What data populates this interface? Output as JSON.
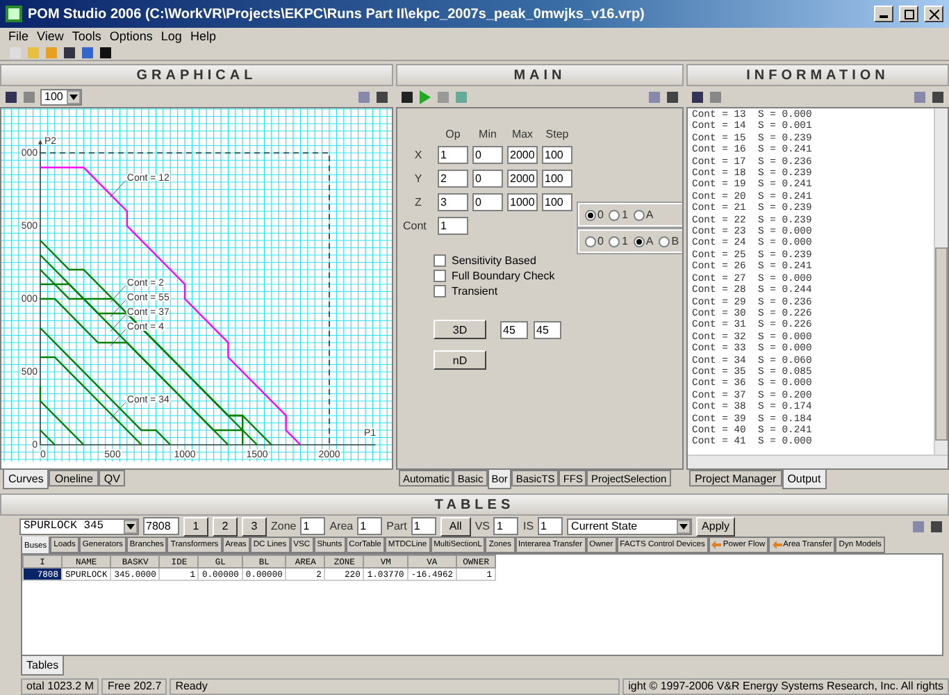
{
  "window": {
    "title": "POM Studio 2006 (C:\\WorkVR\\Projects\\EKPC\\Runs Part II\\ekpc_2007s_peak_0mwjks_v16.vrp)"
  },
  "menu": [
    "File",
    "View",
    "Tools",
    "Options",
    "Log",
    "Help"
  ],
  "graphical": {
    "title": "GRAPHICAL",
    "zoom": "100",
    "y_tick_labels": [
      "000",
      "500",
      "000"
    ],
    "chart_data": {
      "type": "line",
      "xlabel": "P1",
      "ylabel": "P2",
      "xlim": [
        0,
        2300
      ],
      "ylim": [
        0,
        2100
      ],
      "grid": true,
      "xticks": [
        0,
        500,
        1000,
        1500,
        2000
      ],
      "yticks": [
        0,
        500
      ],
      "series": [
        {
          "color": "#ff00ff",
          "x": [
            0,
            300,
            600,
            600,
            1000,
            1000,
            1300,
            1300,
            1700,
            1700,
            1800
          ],
          "values": [
            1900,
            1900,
            1600,
            1500,
            1100,
            1000,
            700,
            600,
            200,
            100,
            0
          ]
        },
        {
          "color": "#008000",
          "x": [
            0,
            200,
            300,
            1500
          ],
          "values": [
            1400,
            1200,
            1200,
            0
          ]
        },
        {
          "color": "#008000",
          "x": [
            0,
            300,
            500,
            1300,
            1400,
            1600
          ],
          "values": [
            1300,
            1000,
            1000,
            200,
            200,
            0
          ]
        },
        {
          "color": "#008000",
          "x": [
            0,
            200,
            300,
            1300
          ],
          "values": [
            1200,
            1000,
            1000,
            0
          ]
        },
        {
          "color": "#008000",
          "x": [
            0,
            200,
            400,
            600,
            1300,
            1400,
            1400
          ],
          "values": [
            1100,
            1100,
            900,
            900,
            200,
            200,
            0
          ]
        },
        {
          "color": "#008000",
          "x": [
            0,
            100,
            400,
            600,
            1200,
            1400
          ],
          "values": [
            1000,
            1000,
            700,
            700,
            100,
            100
          ]
        },
        {
          "color": "#008000",
          "x": [
            0,
            700,
            800,
            900
          ],
          "values": [
            800,
            100,
            100,
            0
          ]
        },
        {
          "color": "#008000",
          "x": [
            0,
            100,
            700
          ],
          "values": [
            600,
            600,
            0
          ]
        },
        {
          "color": "#008000",
          "x": [
            0,
            0,
            300
          ],
          "values": [
            400,
            300,
            0
          ]
        },
        {
          "color": "#008000",
          "x": [
            0,
            100
          ],
          "values": [
            100,
            0
          ]
        }
      ],
      "annotations": [
        "Cont = 12",
        "Cont = 2",
        "Cont = 55",
        "Cont = 37",
        "Cont = 4",
        "Cont = 34"
      ]
    },
    "tabs": [
      {
        "label": "Curves",
        "selected": true
      },
      {
        "label": "Oneline",
        "selected": false
      },
      {
        "label": "QV",
        "selected": false
      }
    ]
  },
  "main": {
    "title": "MAIN",
    "columns": [
      "Op",
      "Min",
      "Max",
      "Step"
    ],
    "rows": [
      {
        "label": "X",
        "values": [
          "1",
          "0",
          "2000",
          "100"
        ]
      },
      {
        "label": "Y",
        "values": [
          "2",
          "0",
          "2000",
          "100"
        ]
      },
      {
        "label": "Z",
        "values": [
          "3",
          "0",
          "1000",
          "100"
        ]
      }
    ],
    "cont": {
      "label": "Cont",
      "value": "1"
    },
    "radio_groups": [
      [
        {
          "label": "0",
          "selected": true
        },
        {
          "label": "1",
          "selected": false
        },
        {
          "label": "A",
          "selected": false
        }
      ],
      [
        {
          "label": "0",
          "selected": false
        },
        {
          "label": "1",
          "selected": false
        },
        {
          "label": "A",
          "selected": true
        },
        {
          "label": "B",
          "selected": false
        }
      ]
    ],
    "checkboxes": [
      {
        "label": "Sensitivity Based",
        "checked": false
      },
      {
        "label": "Full Boundary Check",
        "checked": false
      },
      {
        "label": "Transient",
        "checked": false
      }
    ],
    "button_3d": "3D",
    "angles": [
      "45",
      "45"
    ],
    "button_nd": "nD",
    "tabs": [
      {
        "label": "Automatic",
        "selected": false
      },
      {
        "label": "Basic",
        "selected": false
      },
      {
        "label": "Bor",
        "selected": true
      },
      {
        "label": "BasicTS",
        "selected": false
      },
      {
        "label": "FFS",
        "selected": false
      },
      {
        "label": "ProjectSelection",
        "selected": false
      }
    ]
  },
  "information": {
    "title": "INFORMATION",
    "lines": [
      "Cont = 13  S = 0.000",
      "Cont = 14  S = 0.001",
      "Cont = 15  S = 0.239",
      "Cont = 16  S = 0.241",
      "Cont = 17  S = 0.236",
      "Cont = 18  S = 0.239",
      "Cont = 19  S = 0.241",
      "Cont = 20  S = 0.241",
      "Cont = 21  S = 0.239",
      "Cont = 22  S = 0.239",
      "Cont = 23  S = 0.000",
      "Cont = 24  S = 0.000",
      "Cont = 25  S = 0.239",
      "Cont = 26  S = 0.241",
      "Cont = 27  S = 0.000",
      "Cont = 28  S = 0.244",
      "Cont = 29  S = 0.236",
      "Cont = 30  S = 0.226",
      "Cont = 31  S = 0.226",
      "Cont = 32  S = 0.000",
      "Cont = 33  S = 0.000",
      "Cont = 34  S = 0.060",
      "Cont = 35  S = 0.085",
      "Cont = 36  S = 0.000",
      "Cont = 37  S = 0.200",
      "Cont = 38  S = 0.174",
      "Cont = 39  S = 0.184",
      "Cont = 40  S = 0.241",
      "Cont = 41  S = 0.000"
    ],
    "tabs": [
      {
        "label": "Project Manager",
        "selected": false
      },
      {
        "label": "Output",
        "selected": true
      }
    ]
  },
  "tables": {
    "title": "TABLES",
    "bus": "SPURLOCK 345",
    "bus_number": "7808",
    "pages": [
      "1",
      "2",
      "3"
    ],
    "filters": [
      {
        "label": "Zone",
        "value": "1"
      },
      {
        "label": "Area",
        "value": "1"
      },
      {
        "label": "Part",
        "value": "1"
      }
    ],
    "all": "All",
    "vs": {
      "label": "VS",
      "value": "1"
    },
    "is": {
      "label": "IS",
      "value": "1"
    },
    "state": "Current State",
    "apply": "Apply",
    "tabs": [
      {
        "label": "Buses",
        "selected": true,
        "kind": "plain"
      },
      {
        "label": "Loads",
        "selected": false,
        "kind": "plain"
      },
      {
        "label": "Generators",
        "selected": false,
        "kind": "plain"
      },
      {
        "label": "Branches",
        "selected": false,
        "kind": "plain"
      },
      {
        "label": "Transformers",
        "selected": false,
        "kind": "plain"
      },
      {
        "label": "Areas",
        "selected": false,
        "kind": "plain"
      },
      {
        "label": "DC Lines",
        "selected": false,
        "kind": "plain"
      },
      {
        "label": "VSC",
        "selected": false,
        "kind": "plain"
      },
      {
        "label": "Shunts",
        "selected": false,
        "kind": "plain"
      },
      {
        "label": "CorTable",
        "selected": false,
        "kind": "plain"
      },
      {
        "label": "MTDCLine",
        "selected": false,
        "kind": "plain"
      },
      {
        "label": "MultiSectionL",
        "selected": false,
        "kind": "plain"
      },
      {
        "label": "Zones",
        "selected": false,
        "kind": "plain"
      },
      {
        "label": "Interarea Transfer",
        "selected": false,
        "kind": "plain"
      },
      {
        "label": "Owner",
        "selected": false,
        "kind": "plain"
      },
      {
        "label": "FACTS Control Devices",
        "selected": false,
        "kind": "plain"
      },
      {
        "label": "Power Flow",
        "selected": false,
        "kind": "icon"
      },
      {
        "label": "Area Transfer",
        "selected": false,
        "kind": "icon"
      },
      {
        "label": "Dyn Models",
        "selected": false,
        "kind": "plain"
      }
    ],
    "columns": [
      "I",
      "NAME",
      "BASKV",
      "IDE",
      "GL",
      "BL",
      "AREA",
      "ZONE",
      "VM",
      "VA",
      "OWNER"
    ],
    "rows": [
      {
        "selected": true,
        "cells": [
          "7808",
          "SPURLOCK",
          "345.0000",
          "1",
          "0.00000",
          "0.00000",
          "2",
          "220",
          "1.03770",
          "-16.4962",
          "1"
        ]
      }
    ],
    "bottom_tabs": [
      {
        "label": "Tables",
        "selected": true
      }
    ]
  },
  "status_bar": [
    "otal 1023.2 M",
    "Free 202.7",
    "Ready",
    "ight © 1997-2006 V&R Energy Systems Research, Inc. All rights"
  ]
}
